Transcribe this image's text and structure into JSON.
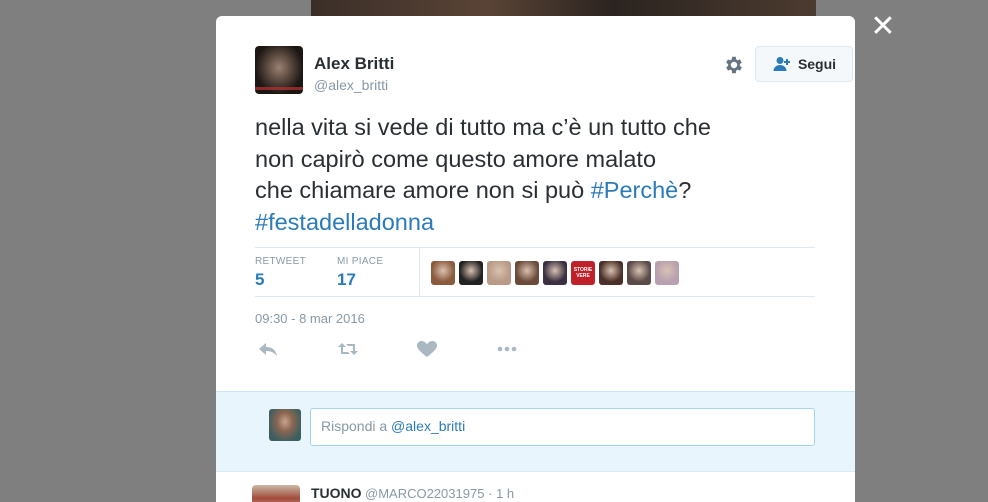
{
  "close_label": "✕",
  "tweet": {
    "fullname": "Alex Britti",
    "username": "@alex_britti",
    "follow_label": "Segui",
    "text_line1": "nella vita si vede di tutto ma c’è un tutto che",
    "text_line2": "non capirò come questo amore malato",
    "text_line3_plain": "che chiamare amore non si può ",
    "hashtag1": "#Perchè",
    "text_line3_end": "?",
    "hashtag2": "#festadelladonna",
    "retweet_label": "RETWEET",
    "retweet_count": "5",
    "likes_label": "MI PIACE",
    "likes_count": "17",
    "timestamp": "09:30 - 8 mar 2016",
    "likers": [
      {
        "color": "#8a5a3c"
      },
      {
        "color": "#222222"
      },
      {
        "color": "#b89a86"
      },
      {
        "color": "#6b4a3a"
      },
      {
        "color": "#3a3040"
      },
      {
        "color": "#c0202a",
        "label": "STORIE VERE"
      },
      {
        "color": "#4a3028"
      },
      {
        "color": "#5a4a48"
      },
      {
        "color": "#b8a0b0"
      }
    ]
  },
  "reply": {
    "prefix": "Rispondi a ",
    "mention": "@alex_britti"
  },
  "next_tweet": {
    "name": "TUONO",
    "meta": "@MARCO22031975 · 1 h"
  },
  "colors": {
    "link": "#2b7bb9",
    "reply_bg": "#e8f5fd"
  }
}
